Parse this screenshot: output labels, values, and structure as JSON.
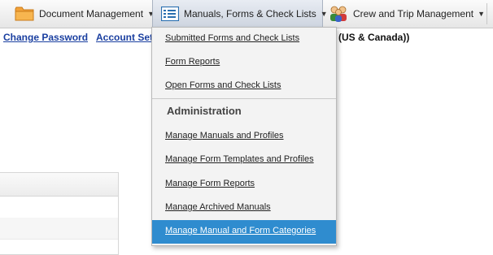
{
  "nav": {
    "document_management": "Document Management",
    "manuals_forms": "Manuals, Forms & Check Lists",
    "crew_trip": "Crew and Trip Management",
    "caret": "▼"
  },
  "sublinks": {
    "change_password": "Change Password",
    "account_settings": "Account Sett",
    "timezone_fragment": "e (US & Canada))"
  },
  "dropdown": {
    "items": [
      "Submitted Forms and Check Lists",
      "Form Reports",
      "Open Forms and Check Lists"
    ],
    "admin_heading": "Administration",
    "admin_items": [
      "Manage Manuals and Profiles",
      "Manage Form Templates and Profiles",
      "Manage Form Reports",
      "Manage Archived Manuals",
      "Manage Manual and Form Categories"
    ]
  },
  "colors": {
    "highlight": "#2f8ccf",
    "link": "#1a3fa0",
    "folder": "#f2a23a"
  }
}
